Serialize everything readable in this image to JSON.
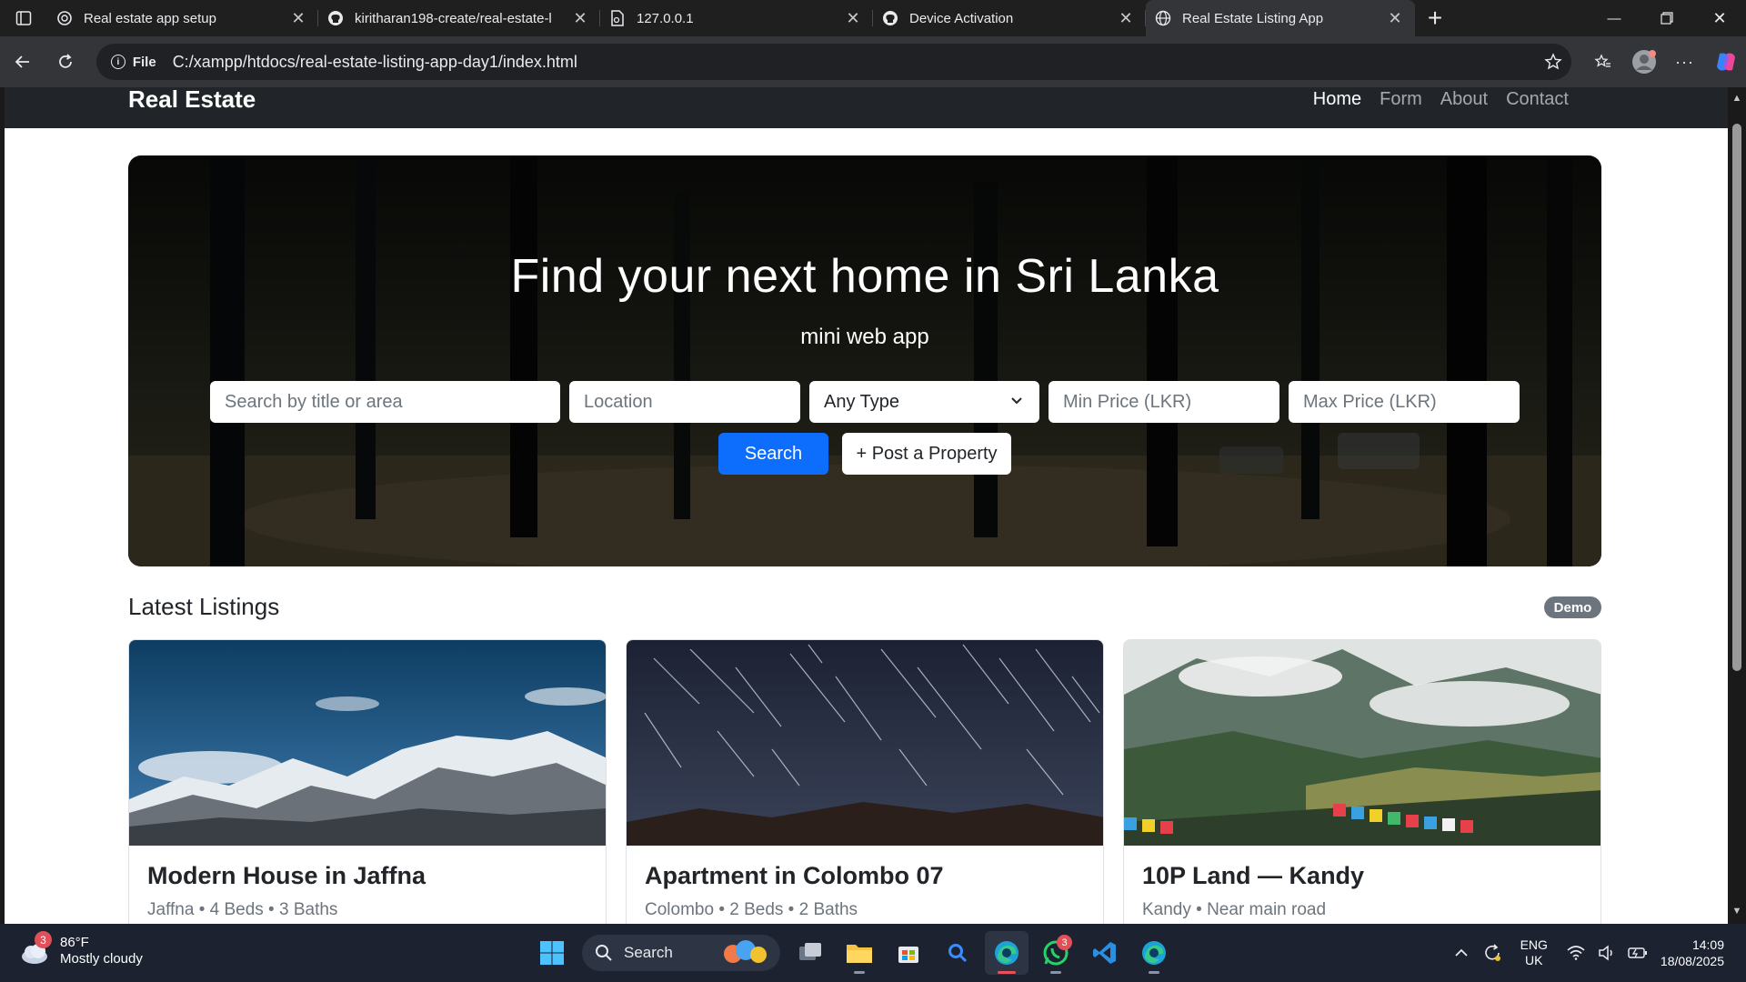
{
  "browser": {
    "tabs": [
      {
        "title": "Real estate app setup",
        "icon": "openai-icon"
      },
      {
        "title": "kiritharan198-create/real-estate-l",
        "icon": "github-icon"
      },
      {
        "title": "127.0.0.1",
        "icon": "file-icon"
      },
      {
        "title": "Device Activation",
        "icon": "github-icon"
      },
      {
        "title": "Real Estate Listing App",
        "icon": "globe-icon"
      }
    ],
    "address": {
      "scheme_label": "File",
      "url": "C:/xampp/htdocs/real-estate-listing-app-day1/index.html"
    }
  },
  "site": {
    "brand": "Real Estate",
    "nav": [
      "Home",
      "Form",
      "About",
      "Contact"
    ],
    "active_nav": "Home"
  },
  "hero": {
    "title": "Find your next home in Sri Lanka",
    "subtitle": "mini web app",
    "search_placeholder": "Search by title or area",
    "location_placeholder": "Location",
    "type_selected": "Any Type",
    "min_price_placeholder": "Min Price (LKR)",
    "max_price_placeholder": "Max Price (LKR)",
    "search_button": "Search",
    "post_button": "+ Post a Property"
  },
  "listings": {
    "heading": "Latest Listings",
    "badge": "Demo",
    "items": [
      {
        "title": "Modern House in Jaffna",
        "meta": "Jaffna • 4 Beds • 3 Baths"
      },
      {
        "title": "Apartment in Colombo 07",
        "meta": "Colombo • 2 Beds • 2 Baths"
      },
      {
        "title": "10P Land — Kandy",
        "meta": "Kandy • Near main road"
      }
    ]
  },
  "taskbar": {
    "weather_temp": "86°F",
    "weather_desc": "Mostly cloudy",
    "weather_badge": "3",
    "search_label": "Search",
    "whatsapp_badge": "3",
    "lang_line1": "ENG",
    "lang_line2": "UK",
    "time": "14:09",
    "date": "18/08/2025"
  }
}
